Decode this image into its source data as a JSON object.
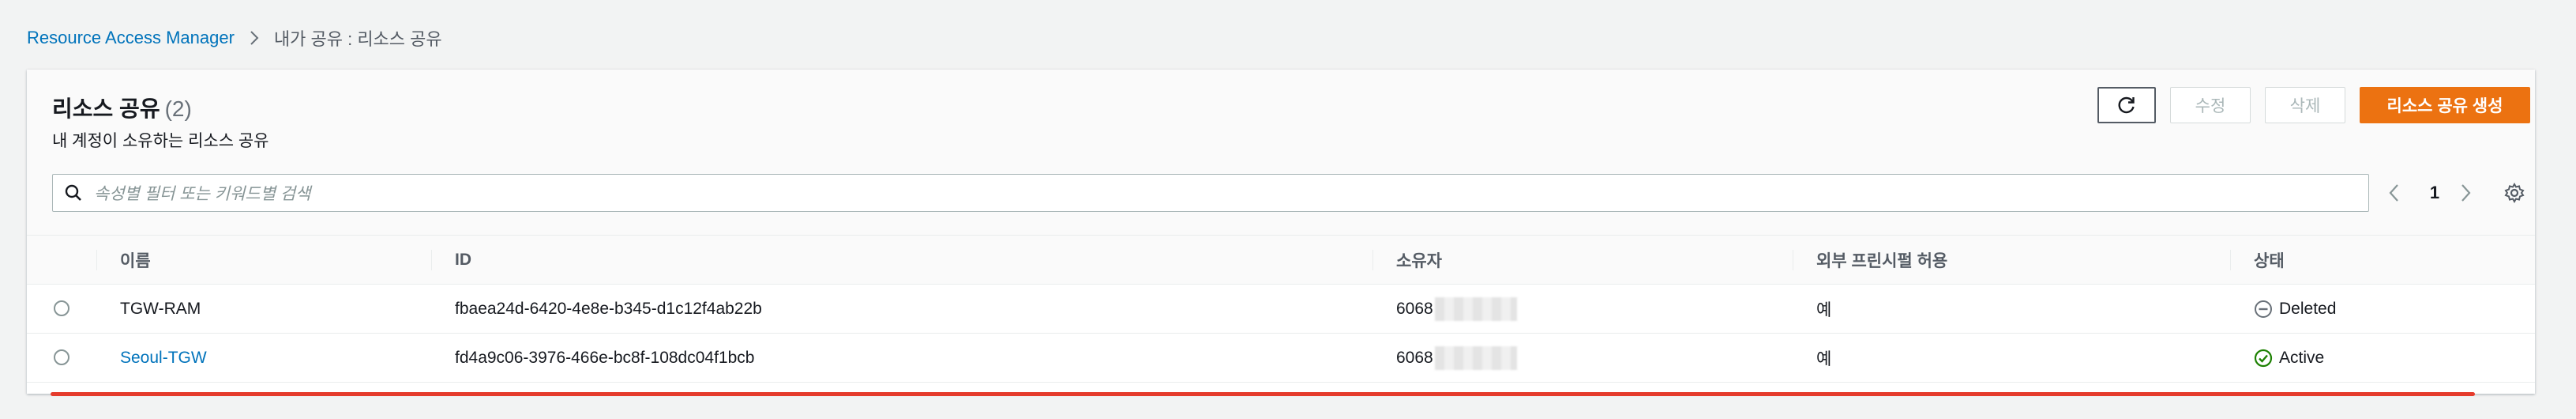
{
  "breadcrumb": {
    "root": "Resource Access Manager",
    "current": "내가 공유 : 리소스 공유"
  },
  "header": {
    "title": "리소스 공유",
    "count": "(2)",
    "subtitle": "내 계정이 소유하는 리소스 공유"
  },
  "toolbar": {
    "refresh_icon": "refresh-icon",
    "edit_label": "수정",
    "delete_label": "삭제",
    "create_label": "리소스 공유 생성"
  },
  "search": {
    "placeholder": "속성별 필터 또는 키워드별 검색"
  },
  "pagination": {
    "current_page": "1"
  },
  "table": {
    "columns": [
      "이름",
      "ID",
      "소유자",
      "외부 프린시펄 허용",
      "상태"
    ],
    "rows": [
      {
        "name": "TGW-RAM",
        "id": "fbaea24d-6420-4e8e-b345-d1c12f4ab22b",
        "owner": "6068",
        "external": "예",
        "status": "Deleted"
      },
      {
        "name": "Seoul-TGW",
        "id": "fd4a9c06-3976-466e-bc8f-108dc04f1bcb",
        "owner": "6068",
        "external": "예",
        "status": "Active"
      }
    ]
  },
  "colors": {
    "accent": "#ec7211",
    "link": "#0073bb",
    "active": "#1d8102",
    "deleted": "#687078",
    "annotation": "#e53b2c"
  }
}
